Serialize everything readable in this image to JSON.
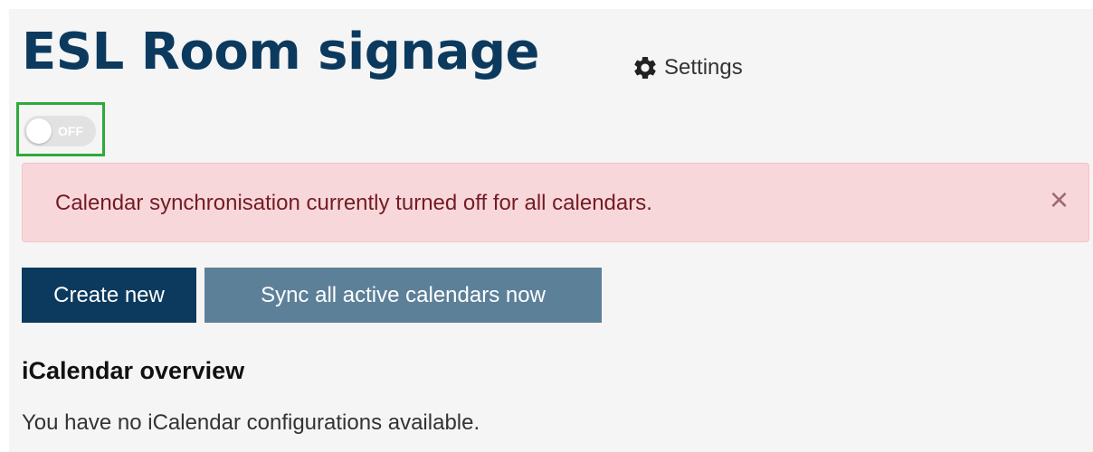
{
  "header": {
    "title": "ESL Room signage",
    "settings_label": "Settings",
    "settings_icon": "gear-icon"
  },
  "sync_toggle": {
    "state_label": "OFF",
    "enabled": false
  },
  "alert": {
    "message": "Calendar synchronisation currently turned off for all calendars.",
    "close_symbol": "×"
  },
  "actions": {
    "create_label": "Create new",
    "sync_label": "Sync all active calendars now"
  },
  "overview": {
    "heading": "iCalendar overview",
    "empty_message": "You have no iCalendar configurations available."
  },
  "colors": {
    "brand": "#0c3a5e",
    "secondary_button": "#5d8099",
    "alert_background": "#f8d7da",
    "alert_text": "#721c24",
    "highlight": "#2eaa3a"
  }
}
